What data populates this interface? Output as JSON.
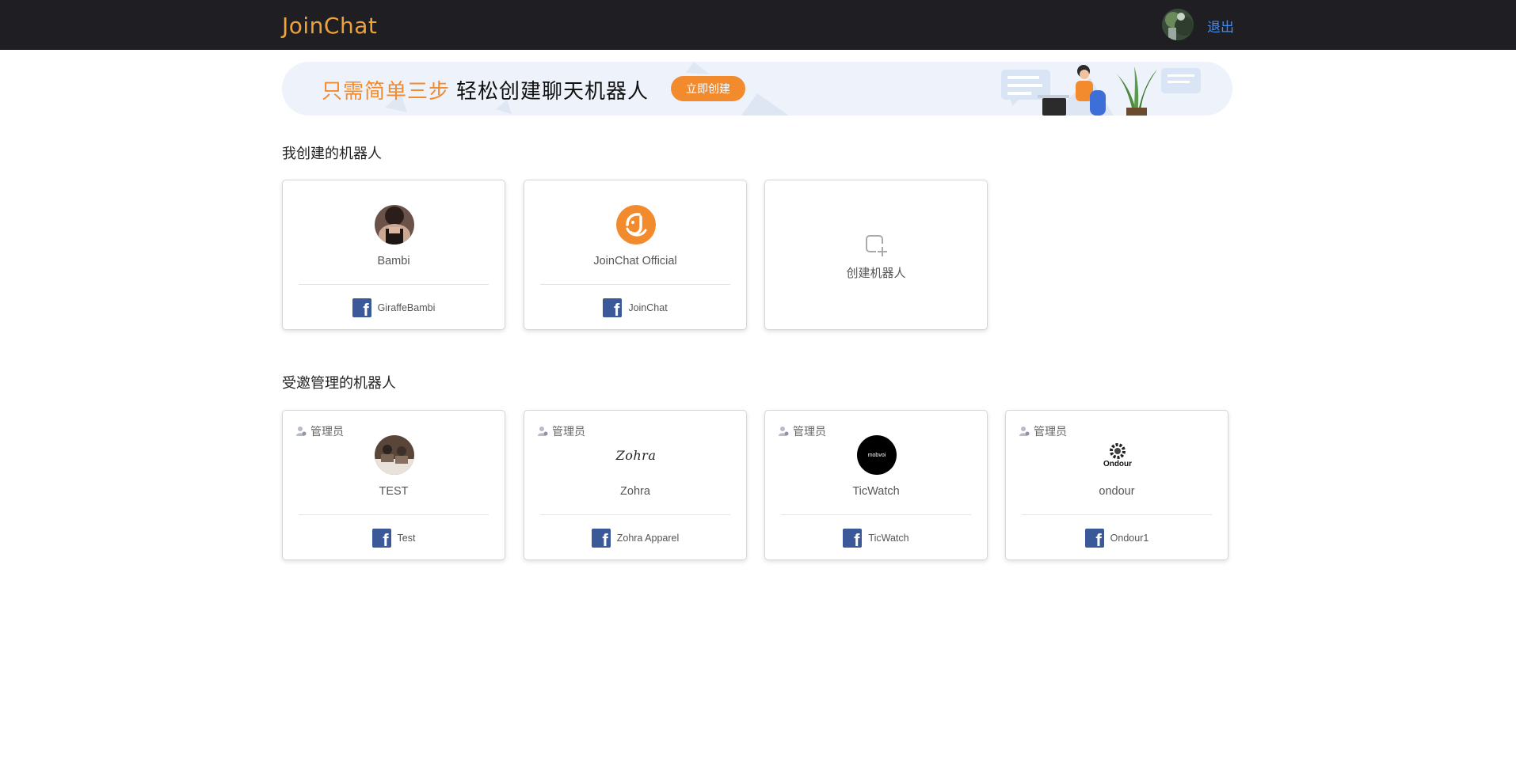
{
  "header": {
    "logo_text": "JoinChat",
    "logout_label": "退出"
  },
  "banner": {
    "highlight": "只需简单三步",
    "text": "轻松创建聊天机器人",
    "button_label": "立即创建"
  },
  "my_bots": {
    "title": "我创建的机器人",
    "items": [
      {
        "name": "Bambi",
        "page": "GiraffeBambi"
      },
      {
        "name": "JoinChat Official",
        "page": "JoinChat"
      }
    ],
    "create_label": "创建机器人"
  },
  "invited_bots": {
    "title": "受邀管理的机器人",
    "role_label": "管理员",
    "items": [
      {
        "name": "TEST",
        "page": "Test"
      },
      {
        "name": "Zohra",
        "page": "Zohra Apparel",
        "logo_text": "Zohra"
      },
      {
        "name": "TicWatch",
        "page": "TicWatch",
        "logo_text": "mobvoi"
      },
      {
        "name": "ondour",
        "page": "Ondour1",
        "logo_text": "Ondour"
      }
    ]
  },
  "colors": {
    "accent": "#f28a2e",
    "link": "#3e8ef7",
    "topbar": "#1f1f23",
    "facebook": "#3b5998"
  }
}
